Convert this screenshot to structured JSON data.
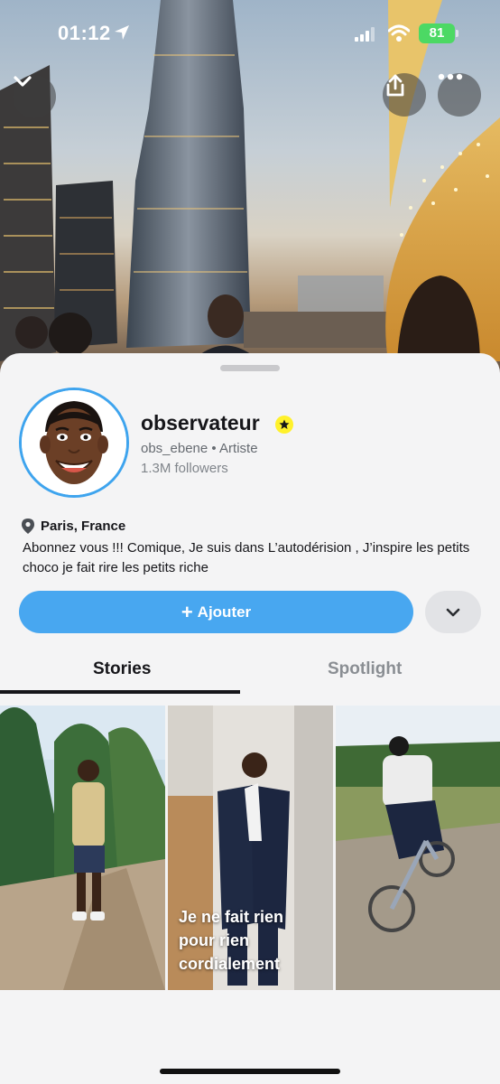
{
  "status_bar": {
    "time": "01:12",
    "battery": "81"
  },
  "profile": {
    "display_name": "observateur",
    "username": "obs_ebene",
    "separator": "•",
    "category": "Artiste",
    "followers": "1.3M followers",
    "location": "Paris, France",
    "bio": "Abonnez vous !!! Comique, Je suis dans L’autodérision , J’inspire les petits choco je fait rire les petits riche"
  },
  "actions": {
    "add_label": "Ajouter",
    "add_plus": "+"
  },
  "tabs": [
    {
      "label": "Stories",
      "active": true
    },
    {
      "label": "Spotlight",
      "active": false
    }
  ],
  "stories": [
    {
      "caption": ""
    },
    {
      "caption_lines": [
        "Je ne fait rien",
        "pour rien",
        "cordialement"
      ]
    },
    {
      "caption": ""
    }
  ],
  "colors": {
    "accent": "#48a7f0",
    "badge": "#fff12b",
    "battery": "#4cd964"
  }
}
